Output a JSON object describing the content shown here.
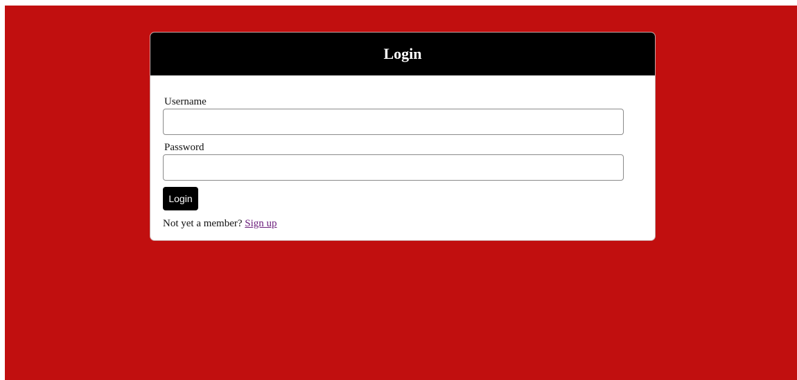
{
  "colors": {
    "page_background": "#c10f0f",
    "card_background": "#ffffff",
    "header_background": "#000000",
    "button_background": "#000000",
    "link_color": "#6a1b7a"
  },
  "card": {
    "title": "Login"
  },
  "form": {
    "username_label": "Username",
    "username_value": "",
    "username_placeholder": "",
    "password_label": "Password",
    "password_value": "",
    "password_placeholder": "",
    "submit_label": "Login"
  },
  "footer": {
    "prompt_text": "Not yet a member?",
    "signup_link_text": "Sign up"
  }
}
